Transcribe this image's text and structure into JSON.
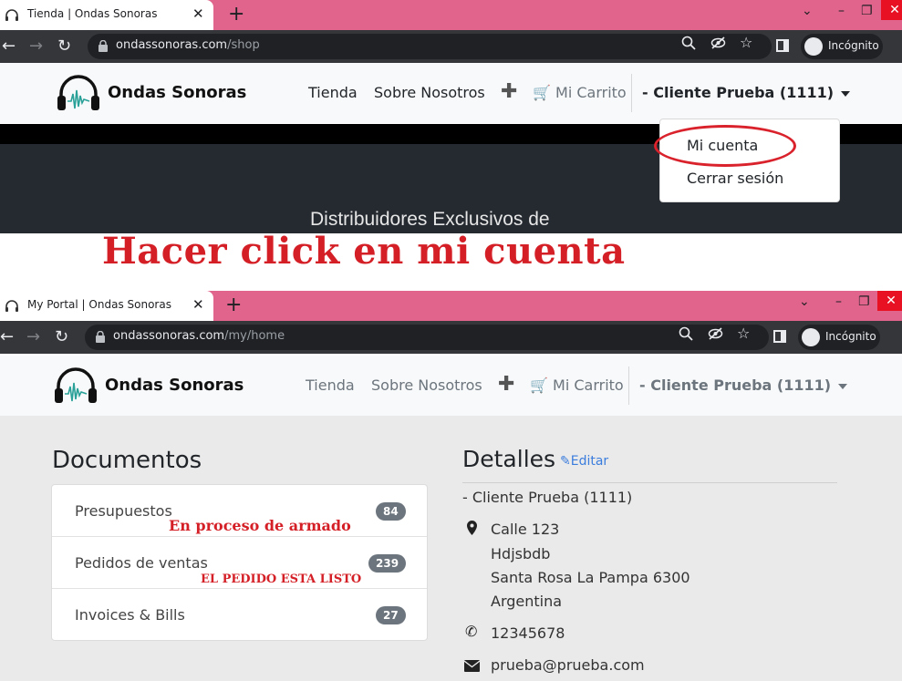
{
  "screenshot1": {
    "tab": {
      "title": "Tienda | Ondas Sonoras",
      "close": "✕"
    },
    "url": {
      "host": "ondassonoras.com",
      "path": "/shop"
    },
    "incognito_label": "Incógnito",
    "site": {
      "brand": "Ondas Sonoras",
      "nav": {
        "shop": "Tienda",
        "about": "Sobre Nosotros",
        "plus": "✚",
        "cart": "Mi Carrito",
        "user": "- Cliente Prueba (1111)"
      }
    },
    "dropdown": {
      "my_account": "Mi cuenta",
      "logout": "Cerrar sesión"
    },
    "hero_text": "Distribuidores Exclusivos de"
  },
  "annotation_main": "Hacer click en mi cuenta",
  "screenshot2": {
    "tab": {
      "title": "My Portal | Ondas Sonoras",
      "close": "✕"
    },
    "url": {
      "host": "ondassonoras.com",
      "path": "/my/home"
    },
    "incognito_label": "Incógnito",
    "site": {
      "brand": "Ondas Sonoras",
      "nav": {
        "shop": "Tienda",
        "about": "Sobre Nosotros",
        "plus": "✚",
        "cart": "Mi Carrito",
        "user": "- Cliente Prueba (1111)"
      }
    },
    "documents": {
      "title": "Documentos",
      "items": [
        {
          "label": "Presupuestos",
          "count": "84",
          "note": "En proceso de armado"
        },
        {
          "label": "Pedidos de ventas",
          "count": "239",
          "note": "EL PEDIDO ESTA LISTO"
        },
        {
          "label": "Invoices & Bills",
          "count": "27"
        }
      ]
    },
    "details": {
      "title": "Detalles",
      "edit": "Editar",
      "name": "- Cliente Prueba (1111)",
      "address": [
        "Calle 123",
        "Hdjsbdb",
        "Santa Rosa La Pampa 6300",
        "Argentina"
      ],
      "phone": "12345678",
      "email": "prueba@prueba.com"
    }
  },
  "colors": {
    "tabstrip": "#e0648c",
    "toolbar": "#35363a",
    "accent_red": "#d41f26",
    "link_blue": "#3b7ddd"
  }
}
